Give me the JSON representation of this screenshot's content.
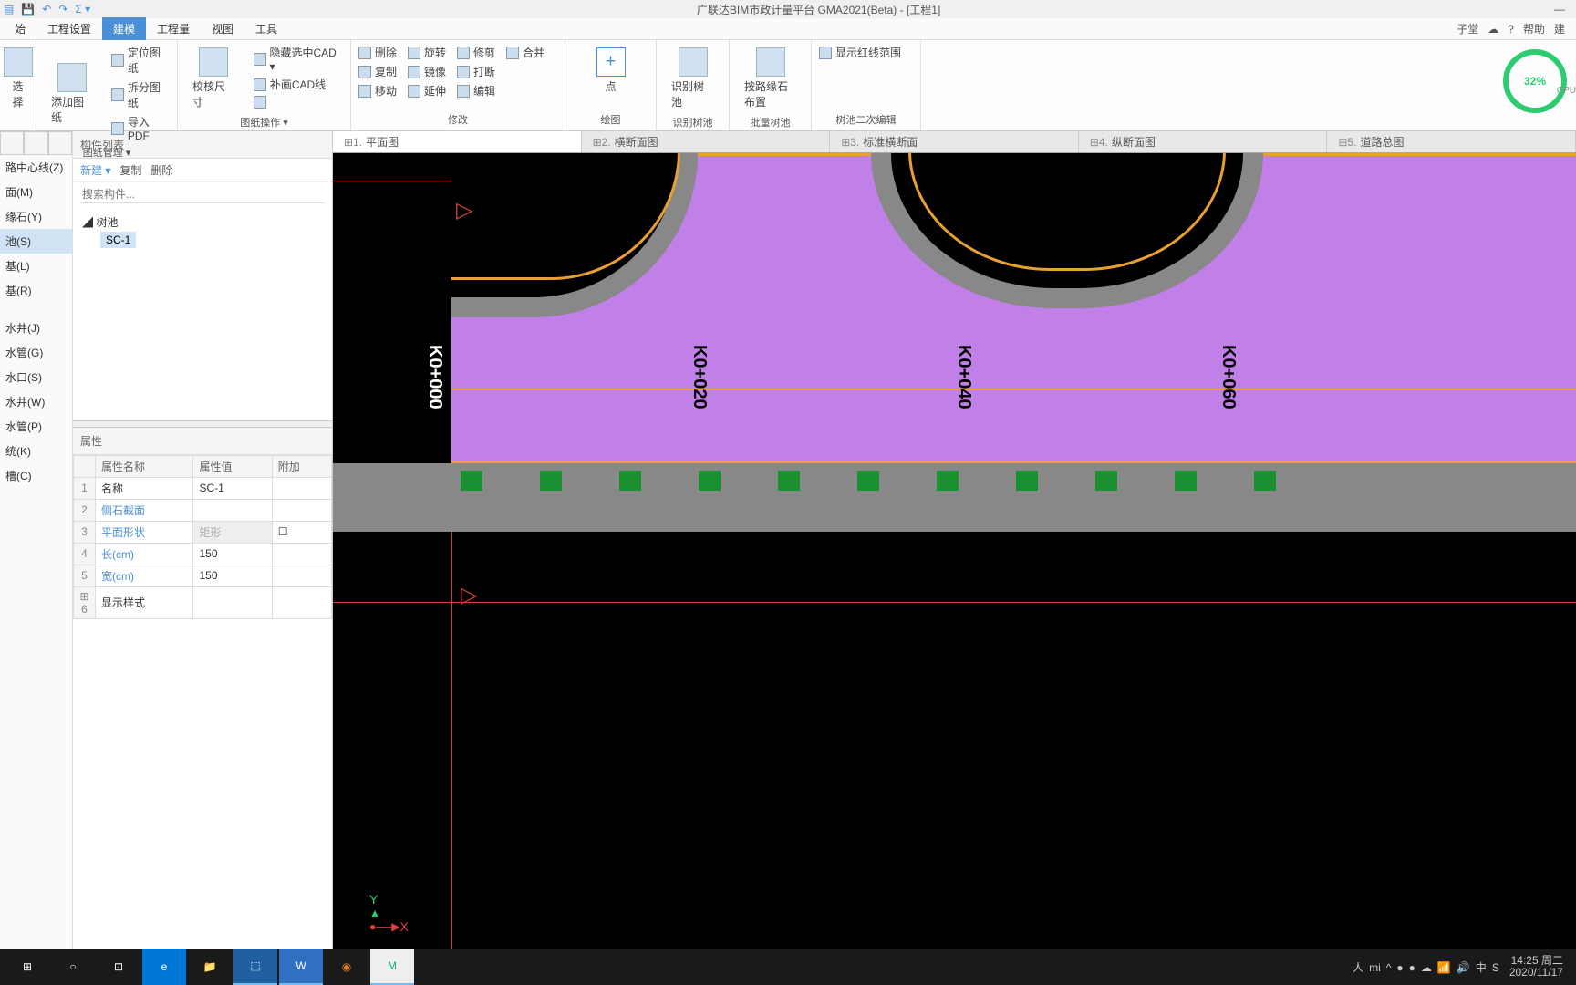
{
  "titlebar": {
    "title": "广联达BIM市政计量平台 GMA2021(Beta) - [工程1]"
  },
  "menubar": {
    "tabs": [
      "始",
      "工程设置",
      "建模",
      "工程量",
      "视图",
      "工具"
    ],
    "active": 2,
    "right": {
      "user": "子堂",
      "help": "帮助",
      "new": "建"
    }
  },
  "ribbon": {
    "groups": [
      {
        "label": "图纸管理 ▾",
        "big": {
          "label": "添加图纸"
        },
        "side_big": {
          "label": "选择"
        },
        "items": [
          "定位图纸",
          "拆分图纸",
          "导入PDF"
        ]
      },
      {
        "label": "图纸操作 ▾",
        "big": {
          "label": "校核尺寸"
        },
        "items": [
          "隐藏选中CAD ▾",
          "补画CAD线",
          ""
        ]
      },
      {
        "label": "修改",
        "cols": [
          [
            "删除",
            "复制",
            "移动"
          ],
          [
            "旋转",
            "镜像",
            "延伸"
          ],
          [
            "修剪",
            "打断",
            "编辑"
          ],
          [
            "合并",
            "",
            ""
          ]
        ]
      },
      {
        "label": "绘图",
        "big": {
          "label": "点"
        }
      },
      {
        "label": "识别树池",
        "big": {
          "label": "识别树池"
        }
      },
      {
        "label": "批量树池",
        "big": {
          "label": "按路缘石布置"
        }
      },
      {
        "label": "树池二次编辑",
        "items": [
          "显示红线范围"
        ]
      }
    ],
    "cpu": "32%",
    "cpu_label": "CPU"
  },
  "left_nav": {
    "items": [
      "路中心线(Z)",
      "面(M)",
      "缘石(Y)",
      "池(S)",
      "基(L)",
      "基(R)",
      "水井(J)",
      "水管(G)",
      "水口(S)",
      "水井(W)",
      "水管(P)",
      "统(K)",
      "槽(C)"
    ],
    "selected": 3
  },
  "mid": {
    "list_header": "构件列表",
    "toolbar": {
      "new": "新建 ▾",
      "copy": "复制",
      "del": "删除"
    },
    "search_placeholder": "搜索构件...",
    "tree": {
      "root": "树池",
      "leaf": "SC-1"
    },
    "prop_header": "属性",
    "prop_cols": [
      "",
      "属性名称",
      "属性值",
      "附加"
    ],
    "props": [
      {
        "n": "1",
        "name": "名称",
        "val": "SC-1",
        "link": false
      },
      {
        "n": "2",
        "name": "侧石截面",
        "val": "",
        "link": true
      },
      {
        "n": "3",
        "name": "平面形状",
        "val": "矩形",
        "link": true,
        "disabled": true,
        "check": true
      },
      {
        "n": "4",
        "name": "长(cm)",
        "val": "150",
        "link": true
      },
      {
        "n": "5",
        "name": "宽(cm)",
        "val": "150",
        "link": true
      },
      {
        "n": "6",
        "name": "显示样式",
        "val": "",
        "expand": true
      }
    ]
  },
  "view_tabs": [
    {
      "n": "1",
      "label": "平面图",
      "active": true
    },
    {
      "n": "2",
      "label": "横断面图"
    },
    {
      "n": "3",
      "label": "标准横断面"
    },
    {
      "n": "4",
      "label": "纵断面图"
    },
    {
      "n": "5",
      "label": "道路总图"
    }
  ],
  "stations": [
    "K0+000",
    "K0+020",
    "K0+040",
    "K0+060"
  ],
  "axis": {
    "x": "X",
    "y": "Y"
  },
  "taskbar": {
    "time": "14:25 周二",
    "date": "2020/11/17",
    "tray": [
      "人",
      "mi",
      "^",
      "●",
      "●",
      "☁",
      "📶",
      "🔊",
      "中",
      "S"
    ]
  }
}
